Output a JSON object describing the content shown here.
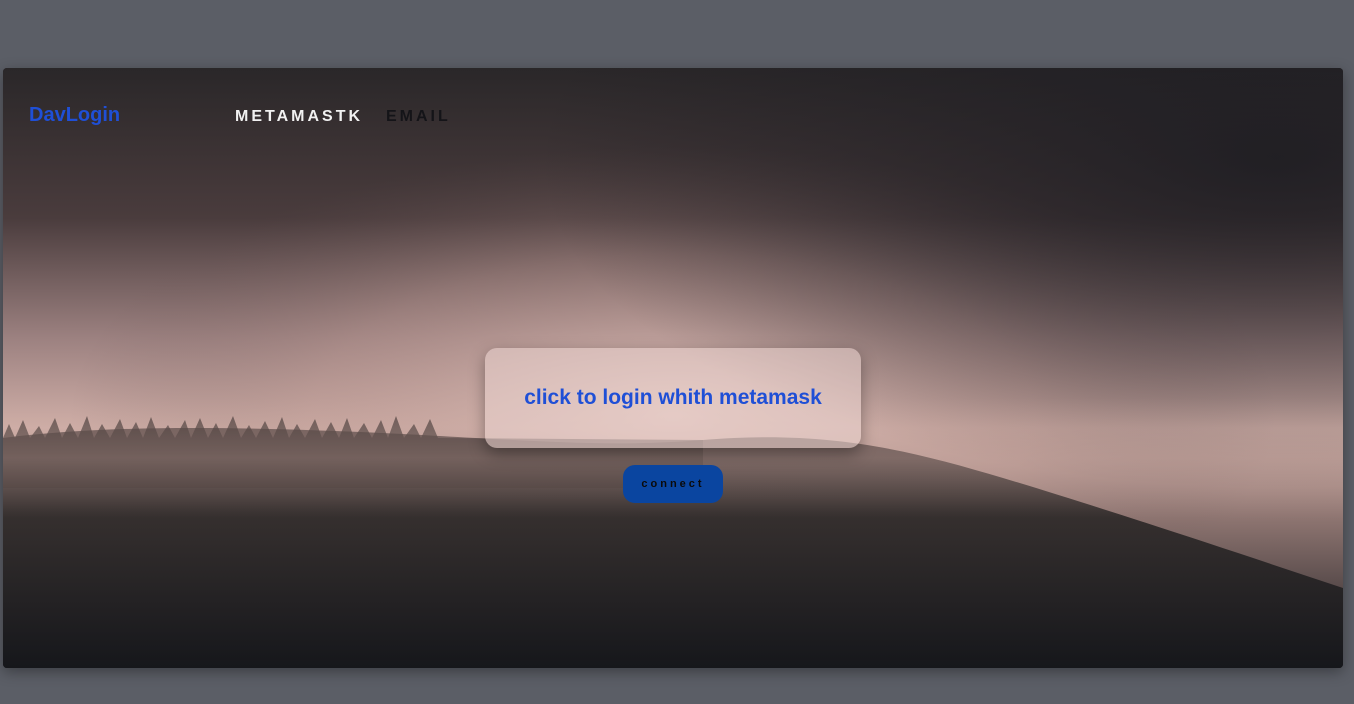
{
  "brand": "DavLogin",
  "nav": {
    "items": [
      {
        "label": "METAMASTK",
        "active": true
      },
      {
        "label": "EMAIL",
        "active": false
      }
    ]
  },
  "login": {
    "title": "click to login whith metamask",
    "button_label": "connect"
  },
  "colors": {
    "page_background": "#5b5e66",
    "accent_blue": "#1f4fd6",
    "button_blue": "#0a45a0",
    "nav_active": "#f1f1f1",
    "nav_inactive": "#141418"
  },
  "background_image": "foggy-forest-hillside"
}
